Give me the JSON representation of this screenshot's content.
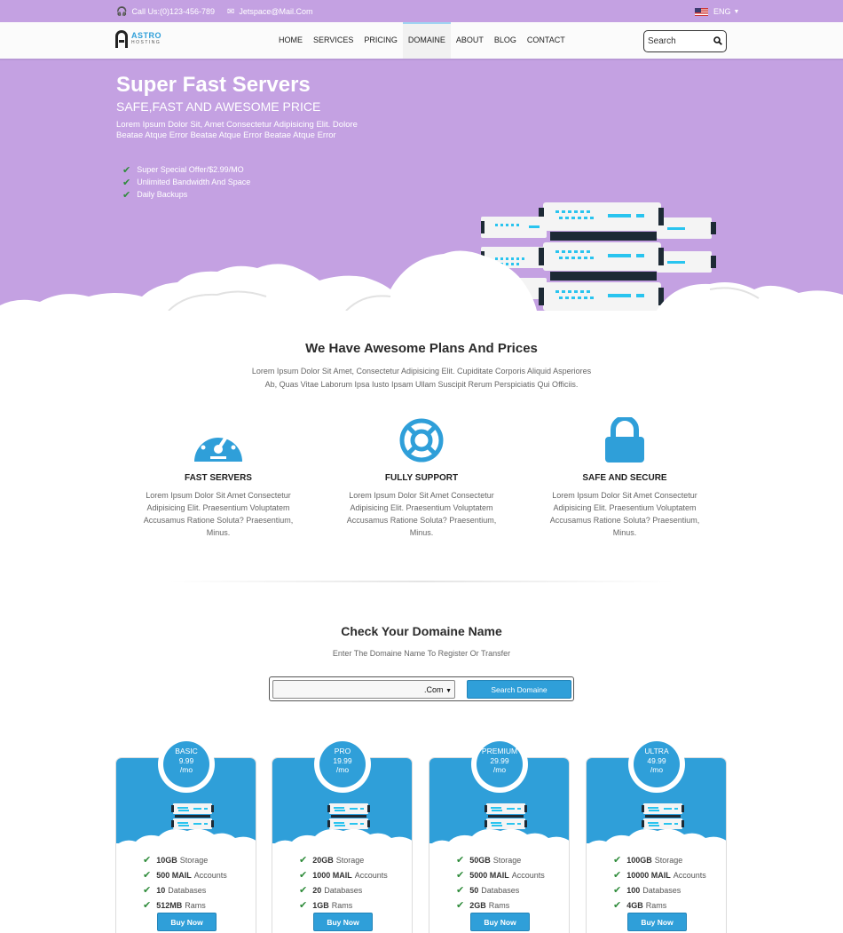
{
  "topbar": {
    "phone": "Call Us:(0)123-456-789",
    "email": "Jetspace@Mail.Com",
    "language": "ENG"
  },
  "nav": {
    "logo_main": "ASTRO",
    "logo_sub": "HOSTING",
    "items": [
      {
        "label": "HOME"
      },
      {
        "label": "SERVICES"
      },
      {
        "label": "PRICING"
      },
      {
        "label": "DOMAINE",
        "active": true
      },
      {
        "label": "ABOUT"
      },
      {
        "label": "BLOG"
      },
      {
        "label": "CONTACT"
      }
    ],
    "search_placeholder": "Search"
  },
  "hero": {
    "title": "Super Fast Servers",
    "subtitle": "SAFE,FAST AND AWESOME PRICE",
    "text": "Lorem Ipsum Dolor Sit, Amet Consectetur Adipisicing Elit. Dolore Beatae Atque Error Beatae Atque Error Beatae Atque Error",
    "bullets": [
      "Super Special Offer/$2.99/MO",
      "Unlimited Bandwidth And Space",
      "Daily Backups"
    ]
  },
  "plans": {
    "title": "We Have Awesome Plans And Prices",
    "subtitle_line1": "Lorem Ipsum Dolor Sit Amet, Consectetur Adipisicing Elit. Cupiditate Corporis Aliquid Asperiores",
    "subtitle_line2": "Ab, Quas Vitae Laborum Ipsa Iusto Ipsam Ullam Suscipit Rerum Perspiciatis Qui Officiis.",
    "features": [
      {
        "icon": "speedometer-icon",
        "title": "FAST SERVERS",
        "text": "Lorem Ipsum Dolor Sit Amet Consectetur Adipisicing Elit. Praesentium Voluptatem Accusamus Ratione Soluta? Praesentium, Minus."
      },
      {
        "icon": "lifebuoy-icon",
        "title": "FULLY SUPPORT",
        "text": "Lorem Ipsum Dolor Sit Amet Consectetur Adipisicing Elit. Praesentium Voluptatem Accusamus Ratione Soluta? Praesentium, Minus."
      },
      {
        "icon": "lock-icon",
        "title": "SAFE AND SECURE",
        "text": "Lorem Ipsum Dolor Sit Amet Consectetur Adipisicing Elit. Praesentium Voluptatem Accusamus Ratione Soluta? Praesentium, Minus."
      }
    ]
  },
  "domain": {
    "title": "Check Your Domaine Name",
    "subtitle": "Enter The Domaine Name To Register Or Transfer",
    "input_value": "",
    "tld": ".Com",
    "button": "Search Domaine"
  },
  "pricing": [
    {
      "name": "BASIC",
      "price": "9.99",
      "period": "/mo",
      "features": [
        [
          "10GB",
          "Storage"
        ],
        [
          "500 MAIL",
          "Accounts"
        ],
        [
          "10",
          "Databases"
        ],
        [
          "512MB",
          "Rams"
        ]
      ],
      "button": "Buy Now"
    },
    {
      "name": "PRO",
      "price": "19.99",
      "period": "/mo",
      "features": [
        [
          "20GB",
          "Storage"
        ],
        [
          "1000 MAIL",
          "Accounts"
        ],
        [
          "20",
          "Databases"
        ],
        [
          "1GB",
          "Rams"
        ]
      ],
      "button": "Buy Now"
    },
    {
      "name": "PREMIUM",
      "price": "29.99",
      "period": "/mo",
      "features": [
        [
          "50GB",
          "Storage"
        ],
        [
          "5000 MAIL",
          "Accounts"
        ],
        [
          "50",
          "Databases"
        ],
        [
          "2GB",
          "Rams"
        ]
      ],
      "button": "Buy Now"
    },
    {
      "name": "ULTRA",
      "price": "49.99",
      "period": "/mo",
      "features": [
        [
          "100GB",
          "Storage"
        ],
        [
          "10000 MAIL",
          "Accounts"
        ],
        [
          "100",
          "Databases"
        ],
        [
          "4GB",
          "Rams"
        ]
      ],
      "button": "Buy Now"
    }
  ],
  "colors": {
    "accent": "#2f9fd9",
    "hero_bg": "#c4a1e2",
    "check": "#2e8b3a"
  }
}
